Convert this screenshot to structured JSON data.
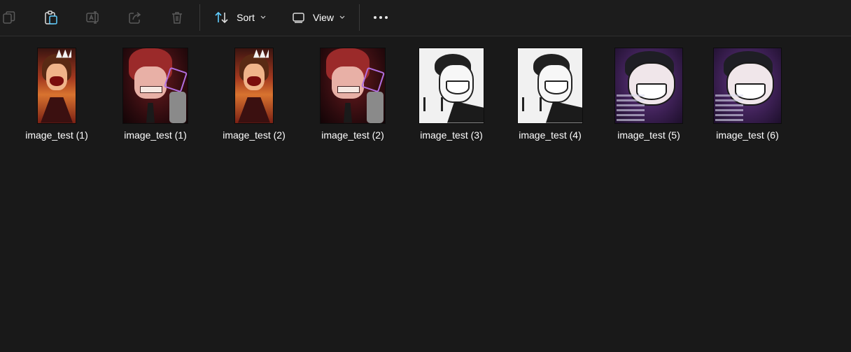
{
  "toolbar": {
    "buttons": [
      {
        "name": "copy-icon",
        "enabled": false
      },
      {
        "name": "paste-icon",
        "enabled": true
      },
      {
        "name": "rename-icon",
        "enabled": false
      },
      {
        "name": "share-icon",
        "enabled": false
      },
      {
        "name": "delete-icon",
        "enabled": false
      }
    ],
    "sort_label": "Sort",
    "view_label": "View",
    "more_icon": "more-icon",
    "accent_color": "#60cdff"
  },
  "files": [
    {
      "name": "image_test (1)",
      "thumb": "tall-screaming-character"
    },
    {
      "name": "image_test (1)",
      "thumb": "red-hair-grin-phone"
    },
    {
      "name": "image_test (2)",
      "thumb": "tall-screaming-character"
    },
    {
      "name": "image_test (2)",
      "thumb": "red-hair-grin-phone"
    },
    {
      "name": "image_test (3)",
      "thumb": "white-bg-grinning-character"
    },
    {
      "name": "image_test (4)",
      "thumb": "white-bg-grinning-character"
    },
    {
      "name": "image_test (5)",
      "thumb": "purple-bg-grinning-character"
    },
    {
      "name": "image_test (6)",
      "thumb": "purple-bg-grinning-character"
    }
  ]
}
